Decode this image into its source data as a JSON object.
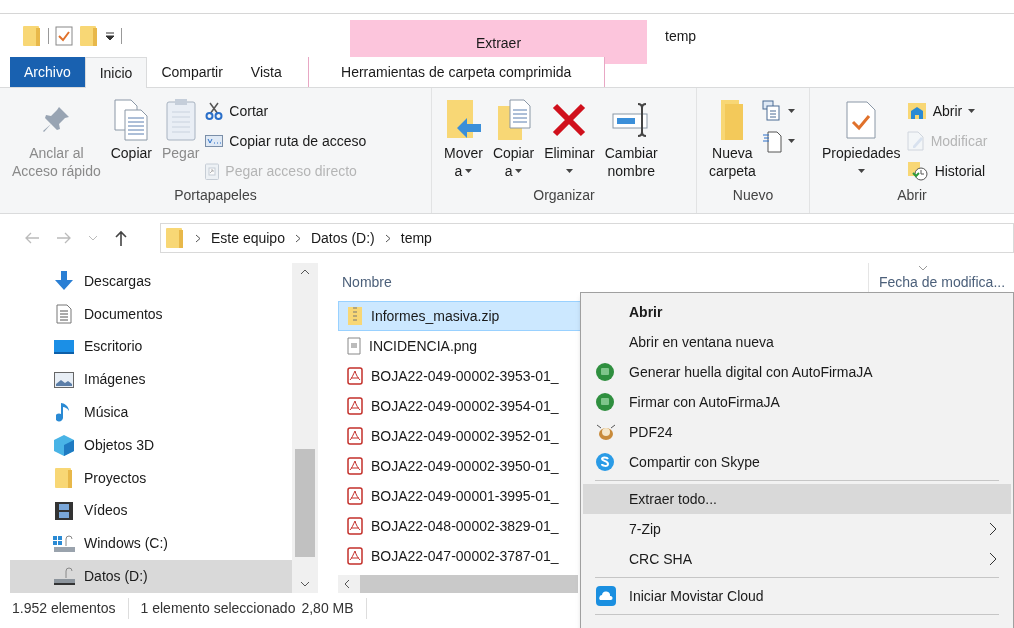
{
  "contextual_header": {
    "label": "Extraer"
  },
  "window": {
    "title": "temp"
  },
  "tabs": [
    {
      "label": "Archivo",
      "kind": "file",
      "selected": false
    },
    {
      "label": "Inicio",
      "kind": "tab",
      "selected": true
    },
    {
      "label": "Compartir",
      "kind": "tab",
      "selected": false
    },
    {
      "label": "Vista",
      "kind": "tab",
      "selected": false
    },
    {
      "label": "Herramientas de carpeta comprimida",
      "kind": "contextual",
      "selected": false
    }
  ],
  "ribbon": [
    {
      "label": "Portapapeles",
      "large": [
        {
          "lines": [
            "Anclar al",
            "Acceso rápido"
          ],
          "disabled": true,
          "dropdown": false
        },
        {
          "lines": [
            "Copiar"
          ],
          "disabled": false,
          "dropdown": false
        },
        {
          "lines": [
            "Pegar"
          ],
          "disabled": true,
          "dropdown": false
        }
      ],
      "small": [
        {
          "label": "Cortar",
          "disabled": false,
          "dropdown": false
        },
        {
          "label": "Copiar ruta de acceso",
          "disabled": false,
          "dropdown": false
        },
        {
          "label": "Pegar acceso directo",
          "disabled": true,
          "dropdown": false
        }
      ]
    },
    {
      "label": "Organizar",
      "large": [
        {
          "lines": [
            "Mover",
            "a"
          ],
          "disabled": false,
          "dropdown": true
        },
        {
          "lines": [
            "Copiar",
            "a"
          ],
          "disabled": false,
          "dropdown": true
        },
        {
          "lines": [
            "Eliminar"
          ],
          "disabled": false,
          "dropdown": true
        },
        {
          "lines": [
            "Cambiar",
            "nombre"
          ],
          "disabled": false,
          "dropdown": false
        }
      ]
    },
    {
      "label": "Nuevo",
      "large": [
        {
          "lines": [
            "Nueva",
            "carpeta"
          ],
          "disabled": false,
          "dropdown": false
        }
      ],
      "small": [
        {
          "disabled": false,
          "dropdown": true
        },
        {
          "disabled": false,
          "dropdown": true
        }
      ]
    },
    {
      "label": "Abrir",
      "large": [
        {
          "lines": [
            "Propiedades"
          ],
          "disabled": false,
          "dropdown": true
        }
      ],
      "small": [
        {
          "label": "Abrir",
          "disabled": false,
          "dropdown": true
        },
        {
          "label": "Modificar",
          "disabled": true,
          "dropdown": false
        },
        {
          "label": "Historial",
          "disabled": false,
          "dropdown": false
        }
      ]
    }
  ],
  "address_bar": {
    "crumbs": [
      "Este equipo",
      "Datos (D:)",
      "temp"
    ]
  },
  "navigation_pane": [
    {
      "label": "Descargas",
      "selected": false
    },
    {
      "label": "Documentos",
      "selected": false
    },
    {
      "label": "Escritorio",
      "selected": false
    },
    {
      "label": "Imágenes",
      "selected": false
    },
    {
      "label": "Música",
      "selected": false
    },
    {
      "label": "Objetos 3D",
      "selected": false
    },
    {
      "label": "Proyectos",
      "selected": false
    },
    {
      "label": "Vídeos",
      "selected": false
    },
    {
      "label": "Windows (C:)",
      "selected": false
    },
    {
      "label": "Datos (D:)",
      "selected": true
    }
  ],
  "file_list": {
    "columns": [
      "Nombre",
      "Fecha de modifica..."
    ],
    "rows": [
      {
        "name": "Informes_masiva.zip",
        "kind": "zip",
        "selected": true
      },
      {
        "name": "INCIDENCIA.png",
        "kind": "image",
        "selected": false
      },
      {
        "name": "BOJA22-049-00002-3953-01_",
        "kind": "pdf",
        "selected": false
      },
      {
        "name": "BOJA22-049-00002-3954-01_",
        "kind": "pdf",
        "selected": false
      },
      {
        "name": "BOJA22-049-00002-3952-01_",
        "kind": "pdf",
        "selected": false
      },
      {
        "name": "BOJA22-049-00002-3950-01_",
        "kind": "pdf",
        "selected": false
      },
      {
        "name": "BOJA22-049-00001-3995-01_",
        "kind": "pdf",
        "selected": false
      },
      {
        "name": "BOJA22-048-00002-3829-01_",
        "kind": "pdf",
        "selected": false
      },
      {
        "name": "BOJA22-047-00002-3787-01_",
        "kind": "pdf",
        "selected": false
      }
    ]
  },
  "status_bar": {
    "count": "1.952 elementos",
    "selection": "1 elemento seleccionado",
    "size": "2,80 MB"
  },
  "context_menu": [
    {
      "label": "Abrir",
      "default": true,
      "selected": false,
      "submenu": false,
      "separator_after": false
    },
    {
      "label": "Abrir en ventana nueva",
      "default": false,
      "selected": false,
      "submenu": false,
      "separator_after": false
    },
    {
      "label": "Generar huella digital con AutoFirmaJA",
      "default": false,
      "selected": false,
      "submenu": false,
      "separator_after": false
    },
    {
      "label": "Firmar con AutoFirmaJA",
      "default": false,
      "selected": false,
      "submenu": false,
      "separator_after": false
    },
    {
      "label": "PDF24",
      "default": false,
      "selected": false,
      "submenu": false,
      "separator_after": false
    },
    {
      "label": "Compartir con Skype",
      "default": false,
      "selected": false,
      "submenu": false,
      "separator_after": true
    },
    {
      "label": "Extraer todo...",
      "default": false,
      "selected": true,
      "submenu": false,
      "separator_after": false
    },
    {
      "label": "7-Zip",
      "default": false,
      "selected": false,
      "submenu": true,
      "separator_after": false
    },
    {
      "label": "CRC SHA",
      "default": false,
      "selected": false,
      "submenu": true,
      "separator_after": true
    },
    {
      "label": "Iniciar Movistar Cloud",
      "default": false,
      "selected": false,
      "submenu": false,
      "separator_after": true
    }
  ]
}
